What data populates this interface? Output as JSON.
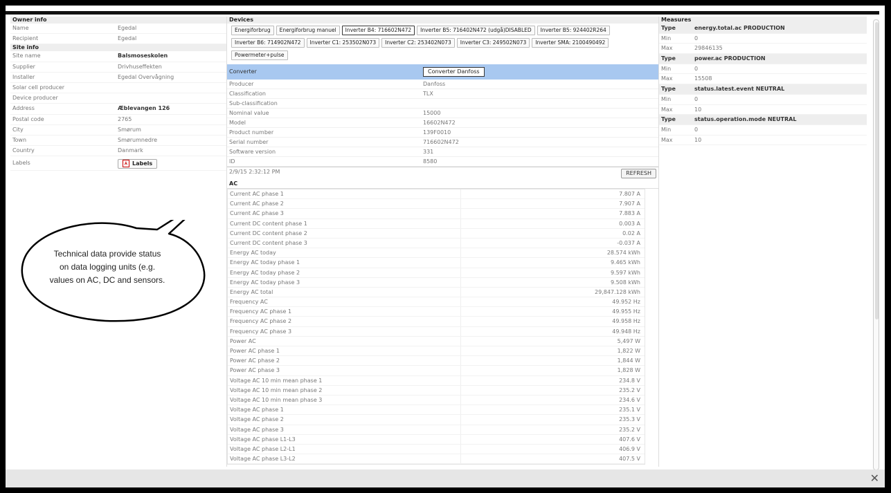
{
  "owner": {
    "header": "Owner info",
    "rows": [
      {
        "k": "Name",
        "v": "Egedal"
      },
      {
        "k": "Recipient",
        "v": "Egedal"
      }
    ]
  },
  "site": {
    "header": "Site info",
    "rows": [
      {
        "k": "Site name",
        "v": "Balsmoseskolen",
        "bold": true
      },
      {
        "k": "Supplier",
        "v": "Drivhuseffekten"
      },
      {
        "k": "Installer",
        "v": "Egedal Overvågning"
      },
      {
        "k": "Solar cell producer",
        "v": ""
      },
      {
        "k": "Device producer",
        "v": ""
      },
      {
        "k": "Address",
        "v": "Æblevangen 126",
        "bold": true
      },
      {
        "k": "Postal code",
        "v": "2765"
      },
      {
        "k": "City",
        "v": "Smørum"
      },
      {
        "k": "Town",
        "v": "Smørumnedre"
      },
      {
        "k": "Country",
        "v": "Danmark"
      }
    ],
    "labels_key": "Labels",
    "labels_button": "Labels"
  },
  "devices": {
    "header": "Devices",
    "buttons": [
      {
        "label": "Energiforbrug",
        "selected": false
      },
      {
        "label": "Energiforbrug manuel",
        "selected": false
      },
      {
        "label": "Inverter B4: 716602N472",
        "selected": true
      },
      {
        "label": "Inverter B5: 716402N472 (udgå)DISABLED",
        "selected": false
      },
      {
        "label": "Inverter B5: 924402R264",
        "selected": false
      },
      {
        "label": "Inverter B6: 714902N472",
        "selected": false
      },
      {
        "label": "Inverter C1: 253502N073",
        "selected": false
      },
      {
        "label": "Inverter C2: 253402N073",
        "selected": false
      },
      {
        "label": "Inverter C3: 249502N073",
        "selected": false
      },
      {
        "label": "Inverter SMA: 2100490492",
        "selected": false
      },
      {
        "label": "Powermeter+pulse",
        "selected": false
      }
    ],
    "converter_label": "Converter",
    "converter_button": "Converter Danfoss",
    "details": [
      {
        "k": "Producer",
        "v": "Danfoss"
      },
      {
        "k": "Classification",
        "v": "TLX"
      },
      {
        "k": "Sub-classification",
        "v": ""
      },
      {
        "k": "Nominal value",
        "v": "15000"
      },
      {
        "k": "Model",
        "v": "16602N472"
      },
      {
        "k": "Product number",
        "v": "139F0010"
      },
      {
        "k": "Serial number",
        "v": "716602N472"
      },
      {
        "k": "Software version",
        "v": "331"
      },
      {
        "k": "ID",
        "v": "8580"
      }
    ],
    "timestamp": "2/9/15 2:32:12 PM",
    "refresh": "REFRESH",
    "ac_header": "AC",
    "ac": [
      {
        "k": "Current AC phase 1",
        "v": "7.807 A"
      },
      {
        "k": "Current AC phase 2",
        "v": "7.907 A"
      },
      {
        "k": "Current AC phase 3",
        "v": "7.883 A"
      },
      {
        "k": "Current DC content phase 1",
        "v": "0.003 A"
      },
      {
        "k": "Current DC content phase 2",
        "v": "0.02 A"
      },
      {
        "k": "Current DC content phase 3",
        "v": "-0.037 A"
      },
      {
        "k": "Energy AC today",
        "v": "28.574 kWh"
      },
      {
        "k": "Energy AC today phase 1",
        "v": "9.465 kWh"
      },
      {
        "k": "Energy AC today phase 2",
        "v": "9.597 kWh"
      },
      {
        "k": "Energy AC today phase 3",
        "v": "9.508 kWh"
      },
      {
        "k": "Energy AC total",
        "v": "29,847.128 kWh"
      },
      {
        "k": "Frequency AC",
        "v": "49.952 Hz"
      },
      {
        "k": "Frequency AC phase 1",
        "v": "49.955 Hz"
      },
      {
        "k": "Frequency AC phase 2",
        "v": "49.958 Hz"
      },
      {
        "k": "Frequency AC phase 3",
        "v": "49.948 Hz"
      },
      {
        "k": "Power AC",
        "v": "5,497 W"
      },
      {
        "k": "Power AC phase 1",
        "v": "1,822 W"
      },
      {
        "k": "Power AC phase 2",
        "v": "1,844 W"
      },
      {
        "k": "Power AC phase 3",
        "v": "1,828 W"
      },
      {
        "k": "Voltage AC 10 min mean phase 1",
        "v": "234.8 V"
      },
      {
        "k": "Voltage AC 10 min mean phase 2",
        "v": "235.2 V"
      },
      {
        "k": "Voltage AC 10 min mean phase 3",
        "v": "234.6 V"
      },
      {
        "k": "Voltage AC phase 1",
        "v": "235.1 V"
      },
      {
        "k": "Voltage AC phase 2",
        "v": "235.3 V"
      },
      {
        "k": "Voltage AC phase 3",
        "v": "235.2 V"
      },
      {
        "k": "Voltage AC phase L1-L3",
        "v": "407.6 V"
      },
      {
        "k": "Voltage AC phase L2-L1",
        "v": "406.9 V"
      },
      {
        "k": "Voltage AC phase L3-L2",
        "v": "407.5 V"
      }
    ]
  },
  "measures": {
    "header": "Measures",
    "rows": [
      {
        "k": "Type",
        "v": "energy.total.ac PRODUCTION",
        "type": true
      },
      {
        "k": "Min",
        "v": "0"
      },
      {
        "k": "Max",
        "v": "29846135"
      },
      {
        "k": "Type",
        "v": "power.ac PRODUCTION",
        "type": true
      },
      {
        "k": "Min",
        "v": "0"
      },
      {
        "k": "Max",
        "v": "15508"
      },
      {
        "k": "Type",
        "v": "status.latest.event NEUTRAL",
        "type": true
      },
      {
        "k": "Min",
        "v": "0"
      },
      {
        "k": "Max",
        "v": "10"
      },
      {
        "k": "Type",
        "v": "status.operation.mode NEUTRAL",
        "type": true
      },
      {
        "k": "Min",
        "v": "0"
      },
      {
        "k": "Max",
        "v": "10"
      }
    ]
  },
  "callout": "Technical data provide status on data logging units (e.g. values on AC, DC and sensors.",
  "close": "✕"
}
